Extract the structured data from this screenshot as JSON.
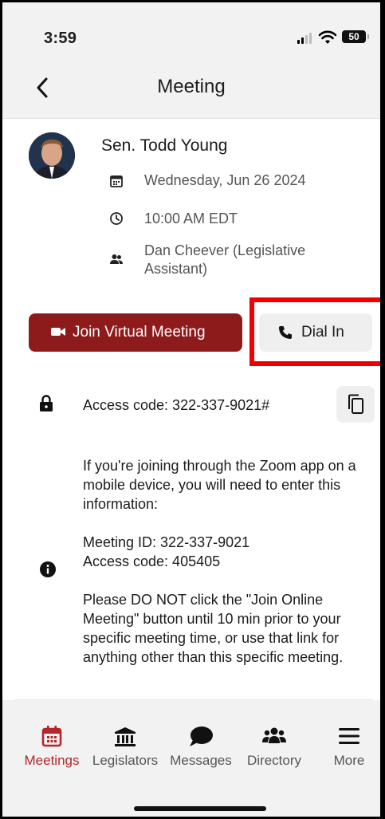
{
  "status_bar": {
    "time": "3:59",
    "battery": "50"
  },
  "nav": {
    "title": "Meeting"
  },
  "meeting": {
    "person": "Sen. Todd Young",
    "date": "Wednesday, Jun 26 2024",
    "time": "10:00 AM EDT",
    "attendee": "Dan Cheever (Legislative Assistant)"
  },
  "actions": {
    "join_label": "Join Virtual Meeting",
    "dial_label": "Dial In"
  },
  "access": {
    "code_text": "Access code: 322-337-9021#"
  },
  "notes": {
    "p1": "If you're joining through the Zoom app on a mobile device, you will need to enter this information:",
    "meeting_id": "Meeting ID: 322-337-9021",
    "access_code": "Access code: 405405",
    "p3": "Please DO NOT click the \"Join Online Meeting\" button until 10 min prior to your specific meeting time, or use that link for anything other than this specific meeting."
  },
  "tabs": [
    {
      "label": "Meetings",
      "icon": "calendar-icon",
      "active": true
    },
    {
      "label": "Legislators",
      "icon": "capitol-icon"
    },
    {
      "label": "Messages",
      "icon": "chat-bubble-icon"
    },
    {
      "label": "Directory",
      "icon": "people-icon"
    },
    {
      "label": "More",
      "icon": "menu-icon"
    }
  ],
  "colors": {
    "accent": "#8e1b1b",
    "active_tab": "#b3262c",
    "highlight": "#ee0000"
  }
}
